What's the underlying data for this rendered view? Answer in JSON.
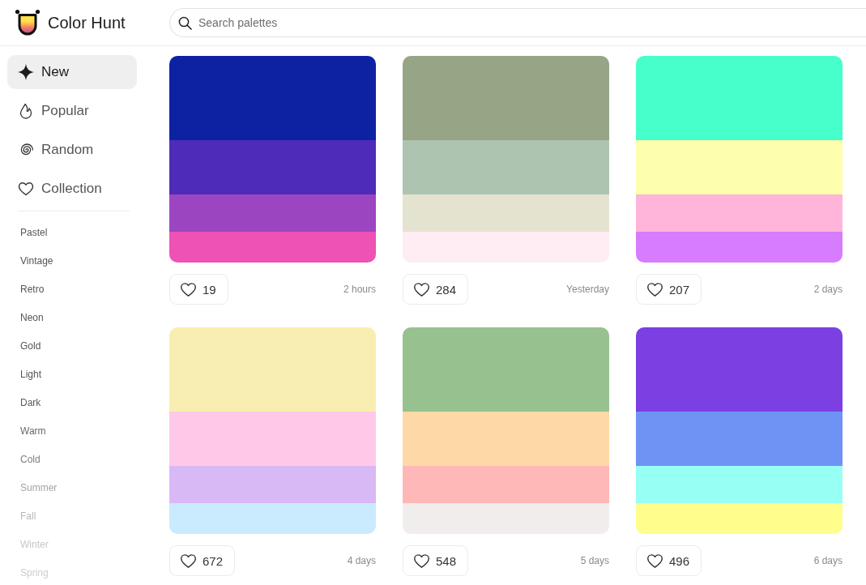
{
  "header": {
    "logo_text": "Color Hunt",
    "search": {
      "placeholder": "Search palettes"
    }
  },
  "sidebar": {
    "nav": [
      {
        "kind": "sparkle",
        "label": "New",
        "selected": true
      },
      {
        "kind": "flame",
        "label": "Popular",
        "selected": false
      },
      {
        "kind": "spiral",
        "label": "Random",
        "selected": false
      },
      {
        "kind": "heart",
        "label": "Collection",
        "selected": false
      }
    ],
    "tags": [
      "Pastel",
      "Vintage",
      "Retro",
      "Neon",
      "Gold",
      "Light",
      "Dark",
      "Warm",
      "Cold",
      "Summer",
      "Fall",
      "Winter",
      "Spring"
    ]
  },
  "palettes": [
    {
      "stripes": [
        {
          "color": "#0d22a3"
        },
        {
          "color": "#4e2bb9"
        },
        {
          "color": "#9c45c1"
        },
        {
          "color": "#ed52b4"
        }
      ],
      "likes": "19",
      "time": "2 hours"
    },
    {
      "stripes": [
        {
          "color": "#97a587"
        },
        {
          "color": "#adc4b0"
        },
        {
          "color": "#e4e3d0"
        },
        {
          "color": "#ffedf3"
        }
      ],
      "likes": "284",
      "time": "Yesterday"
    },
    {
      "stripes": [
        {
          "color": "#47ffca"
        },
        {
          "color": "#fdffac"
        },
        {
          "color": "#ffb4da"
        },
        {
          "color": "#d77bff"
        }
      ],
      "likes": "207",
      "time": "2 days"
    },
    {
      "stripes": [
        {
          "color": "#f9eeb1"
        },
        {
          "color": "#ffc8e9"
        },
        {
          "color": "#d9b8f6"
        },
        {
          "color": "#c9ebfd"
        }
      ],
      "likes": "672",
      "time": "4 days"
    },
    {
      "stripes": [
        {
          "color": "#98c190"
        },
        {
          "color": "#fdd9a8"
        },
        {
          "color": "#ffb8b8"
        },
        {
          "color": "#f2eded"
        }
      ],
      "likes": "548",
      "time": "5 days"
    },
    {
      "stripes": [
        {
          "color": "#7b3fe2"
        },
        {
          "color": "#6f93f4"
        },
        {
          "color": "#97fff4"
        },
        {
          "color": "#fffd8c"
        }
      ],
      "likes": "496",
      "time": "6 days"
    }
  ]
}
